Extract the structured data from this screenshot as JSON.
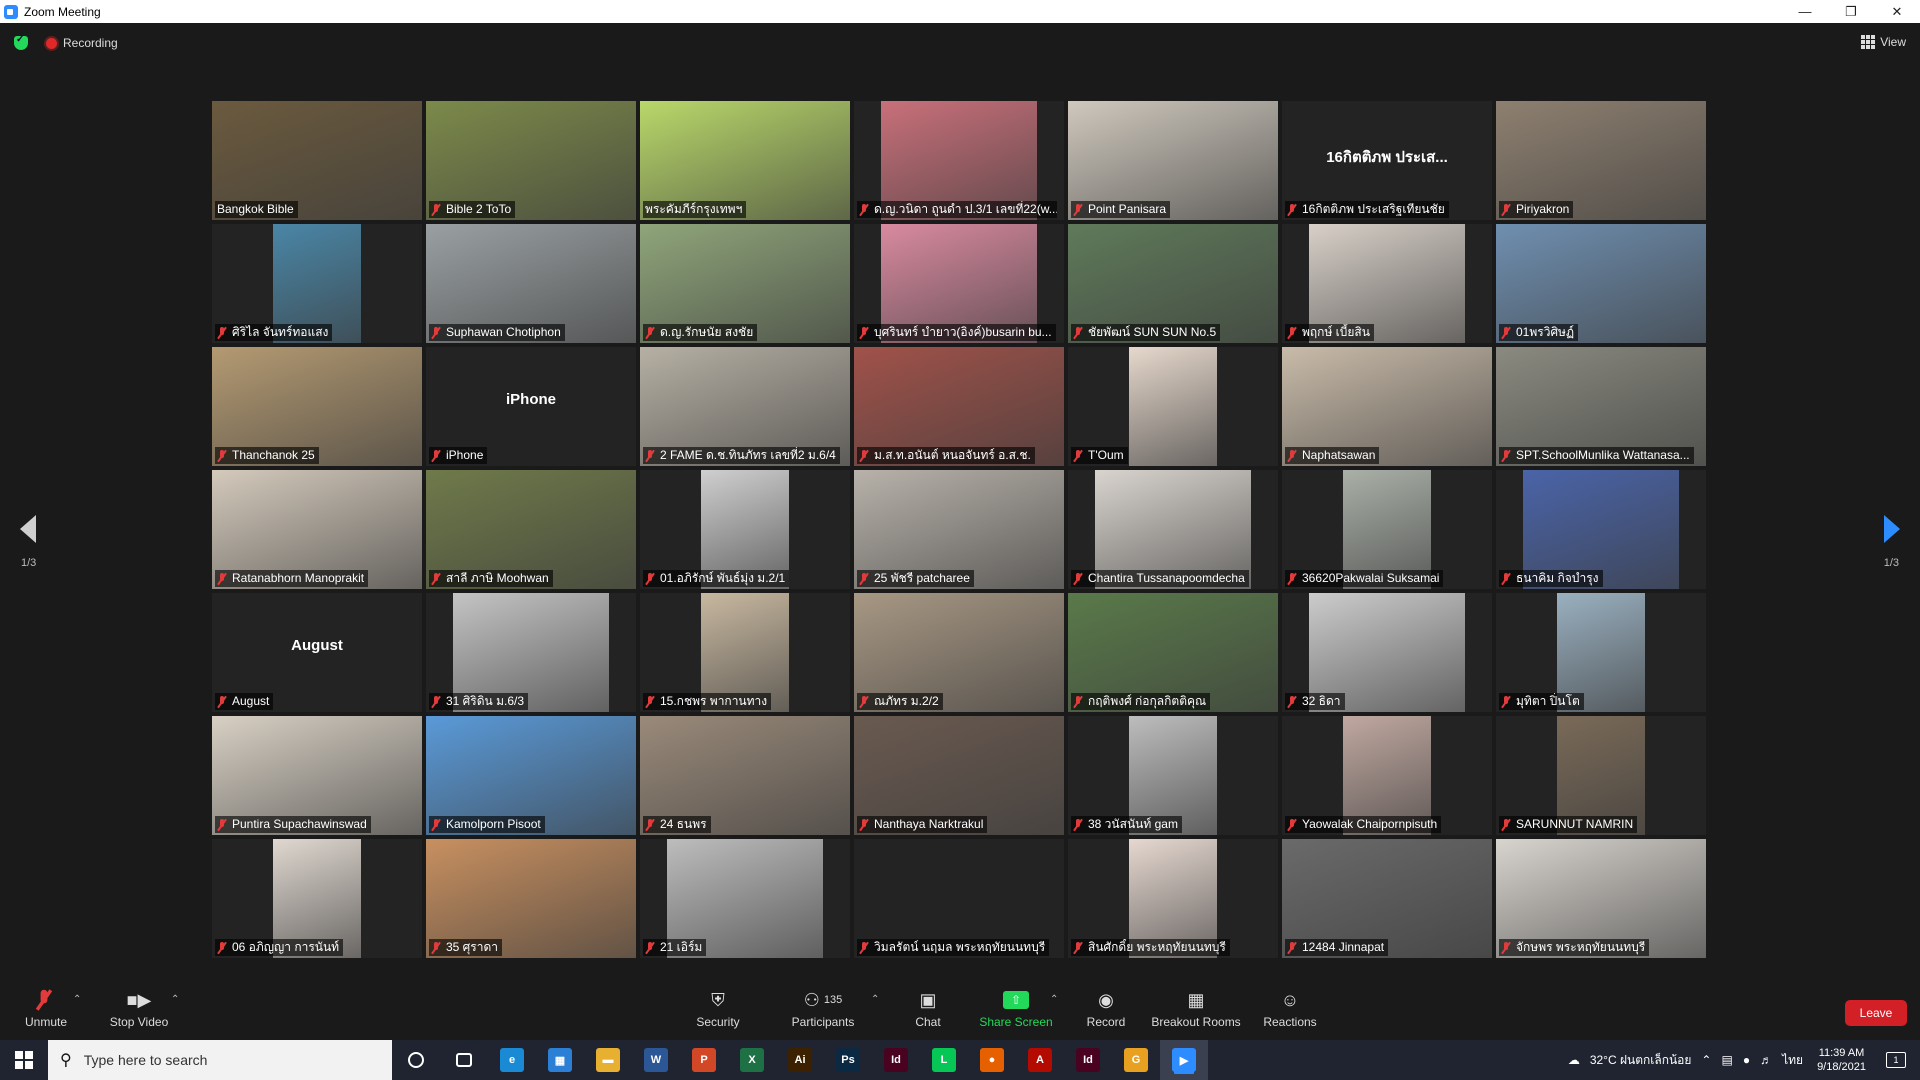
{
  "window": {
    "title": "Zoom Meeting"
  },
  "topbar": {
    "recording_label": "Recording",
    "view_label": "View"
  },
  "pagination": {
    "left": "1/3",
    "right": "1/3"
  },
  "participants": [
    {
      "name": "Bangkok Bible",
      "muted": false,
      "active": true,
      "video": "full",
      "bg": "#6b5a3e"
    },
    {
      "name": "Bible 2 ToTo",
      "muted": true,
      "video": "full",
      "bg": "#7c8a4a"
    },
    {
      "name": "พระคัมภีร์กรุงเทพฯ",
      "muted": false,
      "video": "full",
      "bg": "#b9d86a"
    },
    {
      "name": "ด.ญ.วนิดา ถูนดำ ป.3/1 เลขที่22(w...",
      "muted": true,
      "video": "center",
      "bg": "#c9707a"
    },
    {
      "name": "Point Panisara",
      "muted": true,
      "video": "full",
      "bg": "#cfc8bd"
    },
    {
      "name": "16กิตติภพ ประเสริฐเทียนชัย",
      "muted": true,
      "video": "none",
      "bigname": "16กิตติภพ ประเส...",
      "bg": "#232323"
    },
    {
      "name": "Piriyakron",
      "muted": true,
      "video": "full",
      "bg": "#8e8070"
    },
    {
      "name": "ศิริไล จันทร์ทอแสง",
      "muted": true,
      "video": "narrow",
      "bg": "#4a86a6"
    },
    {
      "name": "Suphawan Chotiphon",
      "muted": true,
      "video": "full",
      "bg": "#9aa0a2"
    },
    {
      "name": "ด.ญ.รักษนัย สงชัย",
      "muted": true,
      "video": "full",
      "bg": "#8fa57a"
    },
    {
      "name": "บุศรินทร์ บำยาว(อิงค์)busarin bu...",
      "muted": true,
      "video": "center",
      "bg": "#d98aa0"
    },
    {
      "name": "ชัยพัฒน์ SUN SUN No.5",
      "muted": true,
      "video": "full",
      "bg": "#5f7a5a"
    },
    {
      "name": "พฤกษ์ เบี้ยสิน",
      "muted": true,
      "video": "center",
      "bg": "#d8d0c8"
    },
    {
      "name": "01พรวิศิษฏ์",
      "muted": true,
      "video": "full",
      "bg": "#6f8fb0"
    },
    {
      "name": "Thanchanok 25",
      "muted": true,
      "video": "full",
      "bg": "#b49a72"
    },
    {
      "name": "iPhone",
      "muted": true,
      "video": "none",
      "bigname": "iPhone",
      "bg": "#232323"
    },
    {
      "name": "2 FAME ด.ช.ทินภัทร เลขที่2 ม.6/4",
      "muted": true,
      "video": "full",
      "bg": "#b6b0a4"
    },
    {
      "name": "ม.ส.ท.อนันต์ หนอจันทร์ อ.ส.ช.",
      "muted": true,
      "video": "full",
      "bg": "#a0524a"
    },
    {
      "name": "T'Oum",
      "muted": true,
      "video": "narrow",
      "bg": "#e6d8cc"
    },
    {
      "name": "Naphatsawan",
      "muted": true,
      "video": "full",
      "bg": "#c9bba9"
    },
    {
      "name": "SPT.SchoolMunlika Wattanasa...",
      "muted": true,
      "video": "full",
      "bg": "#8a8a80"
    },
    {
      "name": "Ratanabhorn Manoprakit",
      "muted": true,
      "video": "full",
      "bg": "#d4cabc"
    },
    {
      "name": "สาลี ภาษิ Moohwan",
      "muted": true,
      "video": "full",
      "bg": "#6f7a4a"
    },
    {
      "name": "01.อภิรักษ์ พันธ์มุ่ง ม.2/1",
      "muted": true,
      "video": "narrow",
      "bg": "#cfcfcf"
    },
    {
      "name": "25 พัชรี patcharee",
      "muted": true,
      "video": "full",
      "bg": "#b8b2aa"
    },
    {
      "name": "Chantira Tussanapoomdecha",
      "muted": true,
      "video": "center",
      "bg": "#d9d4ce"
    },
    {
      "name": "36620Pakwalai Suksamai",
      "muted": true,
      "video": "narrow",
      "bg": "#aab0a8"
    },
    {
      "name": "ธนาคิม กิจบำรุง",
      "muted": true,
      "video": "center",
      "bg": "#4a64a8"
    },
    {
      "name": "August",
      "muted": true,
      "video": "none",
      "bigname": "August",
      "bg": "#232323"
    },
    {
      "name": "31 ศิริดิน ม.6/3",
      "muted": true,
      "video": "center",
      "bg": "#c4c4c4"
    },
    {
      "name": "15.กชพร พากานทาง",
      "muted": true,
      "video": "narrow",
      "bg": "#c8b8a0"
    },
    {
      "name": "ณภัทร ม.2/2",
      "muted": true,
      "video": "full",
      "bg": "#a89884"
    },
    {
      "name": "กฤติพงศ์ ก่อกุลกิตติคุณ",
      "muted": true,
      "video": "full",
      "bg": "#5a7a4a"
    },
    {
      "name": "32 ธิดา",
      "muted": true,
      "video": "center",
      "bg": "#cccccc"
    },
    {
      "name": "มุทิตา ปิ่นโต",
      "muted": true,
      "video": "narrow",
      "bg": "#9ab0c0"
    },
    {
      "name": "Puntira Supachawinswad",
      "muted": true,
      "video": "full",
      "bg": "#d8d0c4"
    },
    {
      "name": "Kamolporn Pisoot",
      "muted": true,
      "video": "full",
      "bg": "#5a9ad8"
    },
    {
      "name": "24 ธนพร",
      "muted": true,
      "video": "full",
      "bg": "#9a8a7a"
    },
    {
      "name": "Nanthaya Narktrakul",
      "muted": true,
      "video": "full",
      "bg": "#6a5a50"
    },
    {
      "name": "38 วนัสนันท์ gam",
      "muted": true,
      "video": "narrow",
      "bg": "#bdbdbd"
    },
    {
      "name": "Yaowalak Chaipornpisuth",
      "muted": true,
      "video": "narrow",
      "bg": "#c0a8a0"
    },
    {
      "name": "SARUNNUT NAMRIN",
      "muted": true,
      "video": "narrow",
      "bg": "#7a6a58"
    },
    {
      "name": "06 อภิญญา การนันท์",
      "muted": true,
      "video": "narrow",
      "bg": "#e0d8d0"
    },
    {
      "name": "35 ศุราดา",
      "muted": true,
      "video": "full",
      "bg": "#c89060"
    },
    {
      "name": "21 เอิร์ม",
      "muted": true,
      "video": "center",
      "bg": "#bdbdbd"
    },
    {
      "name": "วิมลรัตน์ นฤมล พระหฤทัยนนทบุรี",
      "muted": true,
      "video": "none",
      "bg": "#232323"
    },
    {
      "name": "สินศักดิ์ย พระหฤทัยนนทบุรี",
      "muted": true,
      "video": "narrow",
      "bg": "#e6d8d0"
    },
    {
      "name": "12484 Jinnapat",
      "muted": true,
      "video": "full",
      "bg": "#6a6a6a"
    },
    {
      "name": "จักษพร พระหฤทัยนนทบุรี",
      "muted": true,
      "video": "full",
      "bg": "#d8d4ce"
    }
  ],
  "toolbar": {
    "unmute": "Unmute",
    "stop_video": "Stop Video",
    "security": "Security",
    "participants": "Participants",
    "participants_count": "135",
    "chat": "Chat",
    "share_screen": "Share Screen",
    "record": "Record",
    "breakout_rooms": "Breakout Rooms",
    "reactions": "Reactions",
    "leave": "Leave"
  },
  "taskbar": {
    "search_placeholder": "Type here to search",
    "weather": "32°C  ฝนตกเล็กน้อย",
    "lang": "ไทย",
    "time": "11:39 AM",
    "date": "9/18/2021",
    "notifications": "1",
    "apps": [
      {
        "label": "",
        "color": "#00000000",
        "icon": "cortana-icon"
      },
      {
        "label": "",
        "color": "#00000000",
        "icon": "task-view-icon"
      },
      {
        "label": "e",
        "color": "#1a8ad4",
        "icon": "edge-icon"
      },
      {
        "label": "▦",
        "color": "#2b7fd4",
        "icon": "calculator-icon"
      },
      {
        "label": "▬",
        "color": "#e8b030",
        "icon": "file-explorer-icon"
      },
      {
        "label": "W",
        "color": "#2b5797",
        "icon": "word-icon"
      },
      {
        "label": "P",
        "color": "#d24726",
        "icon": "powerpoint-icon"
      },
      {
        "label": "X",
        "color": "#1e7145",
        "icon": "excel-icon"
      },
      {
        "label": "Ai",
        "color": "#3b2100",
        "icon": "illustrator-icon"
      },
      {
        "label": "Ps",
        "color": "#0b2942",
        "icon": "photoshop-icon"
      },
      {
        "label": "Id",
        "color": "#49021f",
        "icon": "indesign-icon"
      },
      {
        "label": "L",
        "color": "#06c755",
        "icon": "line-icon"
      },
      {
        "label": "●",
        "color": "#e66000",
        "icon": "firefox-icon"
      },
      {
        "label": "A",
        "color": "#b30b00",
        "icon": "acrobat-icon"
      },
      {
        "label": "Id",
        "color": "#49021f",
        "icon": "indesign-icon-2"
      },
      {
        "label": "G",
        "color": "#e8a020",
        "icon": "g-app-icon"
      },
      {
        "label": "▶",
        "color": "#2D8CFF",
        "icon": "zoom-icon"
      }
    ]
  }
}
